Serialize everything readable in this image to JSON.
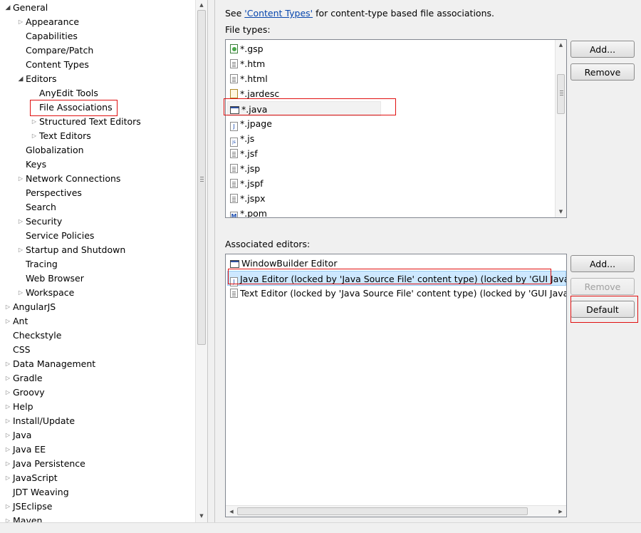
{
  "tree": {
    "items": [
      {
        "label": "General",
        "indent": 0,
        "expander": "open"
      },
      {
        "label": "Appearance",
        "indent": 1,
        "expander": "closed"
      },
      {
        "label": "Capabilities",
        "indent": 1,
        "expander": "none"
      },
      {
        "label": "Compare/Patch",
        "indent": 1,
        "expander": "none"
      },
      {
        "label": "Content Types",
        "indent": 1,
        "expander": "none"
      },
      {
        "label": "Editors",
        "indent": 1,
        "expander": "open"
      },
      {
        "label": "AnyEdit Tools",
        "indent": 2,
        "expander": "none"
      },
      {
        "label": "File Associations",
        "indent": 2,
        "expander": "none",
        "selected": true
      },
      {
        "label": "Structured Text Editors",
        "indent": 2,
        "expander": "closed"
      },
      {
        "label": "Text Editors",
        "indent": 2,
        "expander": "closed"
      },
      {
        "label": "Globalization",
        "indent": 1,
        "expander": "none"
      },
      {
        "label": "Keys",
        "indent": 1,
        "expander": "none"
      },
      {
        "label": "Network Connections",
        "indent": 1,
        "expander": "closed"
      },
      {
        "label": "Perspectives",
        "indent": 1,
        "expander": "none"
      },
      {
        "label": "Search",
        "indent": 1,
        "expander": "none"
      },
      {
        "label": "Security",
        "indent": 1,
        "expander": "closed"
      },
      {
        "label": "Service Policies",
        "indent": 1,
        "expander": "none"
      },
      {
        "label": "Startup and Shutdown",
        "indent": 1,
        "expander": "closed"
      },
      {
        "label": "Tracing",
        "indent": 1,
        "expander": "none"
      },
      {
        "label": "Web Browser",
        "indent": 1,
        "expander": "none"
      },
      {
        "label": "Workspace",
        "indent": 1,
        "expander": "closed"
      },
      {
        "label": "AngularJS",
        "indent": 0,
        "expander": "closed"
      },
      {
        "label": "Ant",
        "indent": 0,
        "expander": "closed"
      },
      {
        "label": "Checkstyle",
        "indent": 0,
        "expander": "none"
      },
      {
        "label": "CSS",
        "indent": 0,
        "expander": "none"
      },
      {
        "label": "Data Management",
        "indent": 0,
        "expander": "closed"
      },
      {
        "label": "Gradle",
        "indent": 0,
        "expander": "closed"
      },
      {
        "label": "Groovy",
        "indent": 0,
        "expander": "closed"
      },
      {
        "label": "Help",
        "indent": 0,
        "expander": "closed"
      },
      {
        "label": "Install/Update",
        "indent": 0,
        "expander": "closed"
      },
      {
        "label": "Java",
        "indent": 0,
        "expander": "closed"
      },
      {
        "label": "Java EE",
        "indent": 0,
        "expander": "closed"
      },
      {
        "label": "Java Persistence",
        "indent": 0,
        "expander": "closed"
      },
      {
        "label": "JavaScript",
        "indent": 0,
        "expander": "closed"
      },
      {
        "label": "JDT Weaving",
        "indent": 0,
        "expander": "none"
      },
      {
        "label": "JSEclipse",
        "indent": 0,
        "expander": "closed"
      },
      {
        "label": "Maven",
        "indent": 0,
        "expander": "closed"
      }
    ]
  },
  "info": {
    "prefix": "See ",
    "link": "'Content Types'",
    "suffix": " for content-type based file associations."
  },
  "file_types": {
    "label": "File types:",
    "items": [
      {
        "name": "*.gsp",
        "icon": "green"
      },
      {
        "name": "*.htm",
        "icon": "doc"
      },
      {
        "name": "*.html",
        "icon": "doc"
      },
      {
        "name": "*.jardesc",
        "icon": "jar"
      },
      {
        "name": "*.java",
        "icon": "wb",
        "selected": true
      },
      {
        "name": "*.jpage",
        "icon": "j"
      },
      {
        "name": "*.js",
        "icon": "js"
      },
      {
        "name": "*.jsf",
        "icon": "doc"
      },
      {
        "name": "*.jsp",
        "icon": "doc"
      },
      {
        "name": "*.jspf",
        "icon": "doc"
      },
      {
        "name": "*.jspx",
        "icon": "doc"
      },
      {
        "name": "*.pom",
        "icon": "m"
      }
    ],
    "add_label": "Add...",
    "remove_label": "Remove"
  },
  "editors": {
    "label": "Associated editors:",
    "items": [
      {
        "name": "WindowBuilder Editor",
        "icon": "wb"
      },
      {
        "name": "Java Editor (locked by 'Java Source File' content type) (locked by 'GUI Java file",
        "icon": "j",
        "selected": true
      },
      {
        "name": "Text Editor (locked by 'Java Source File' content type) (locked by 'GUI Java file",
        "icon": "doc"
      }
    ],
    "add_label": "Add...",
    "remove_label": "Remove",
    "default_label": "Default"
  },
  "icons": {
    "expander_open": "triangle-open-icon",
    "expander_closed": "triangle-closed-icon"
  },
  "colors": {
    "highlight": "#e01010",
    "selection": "#cde8ff",
    "link": "#0645ad"
  }
}
